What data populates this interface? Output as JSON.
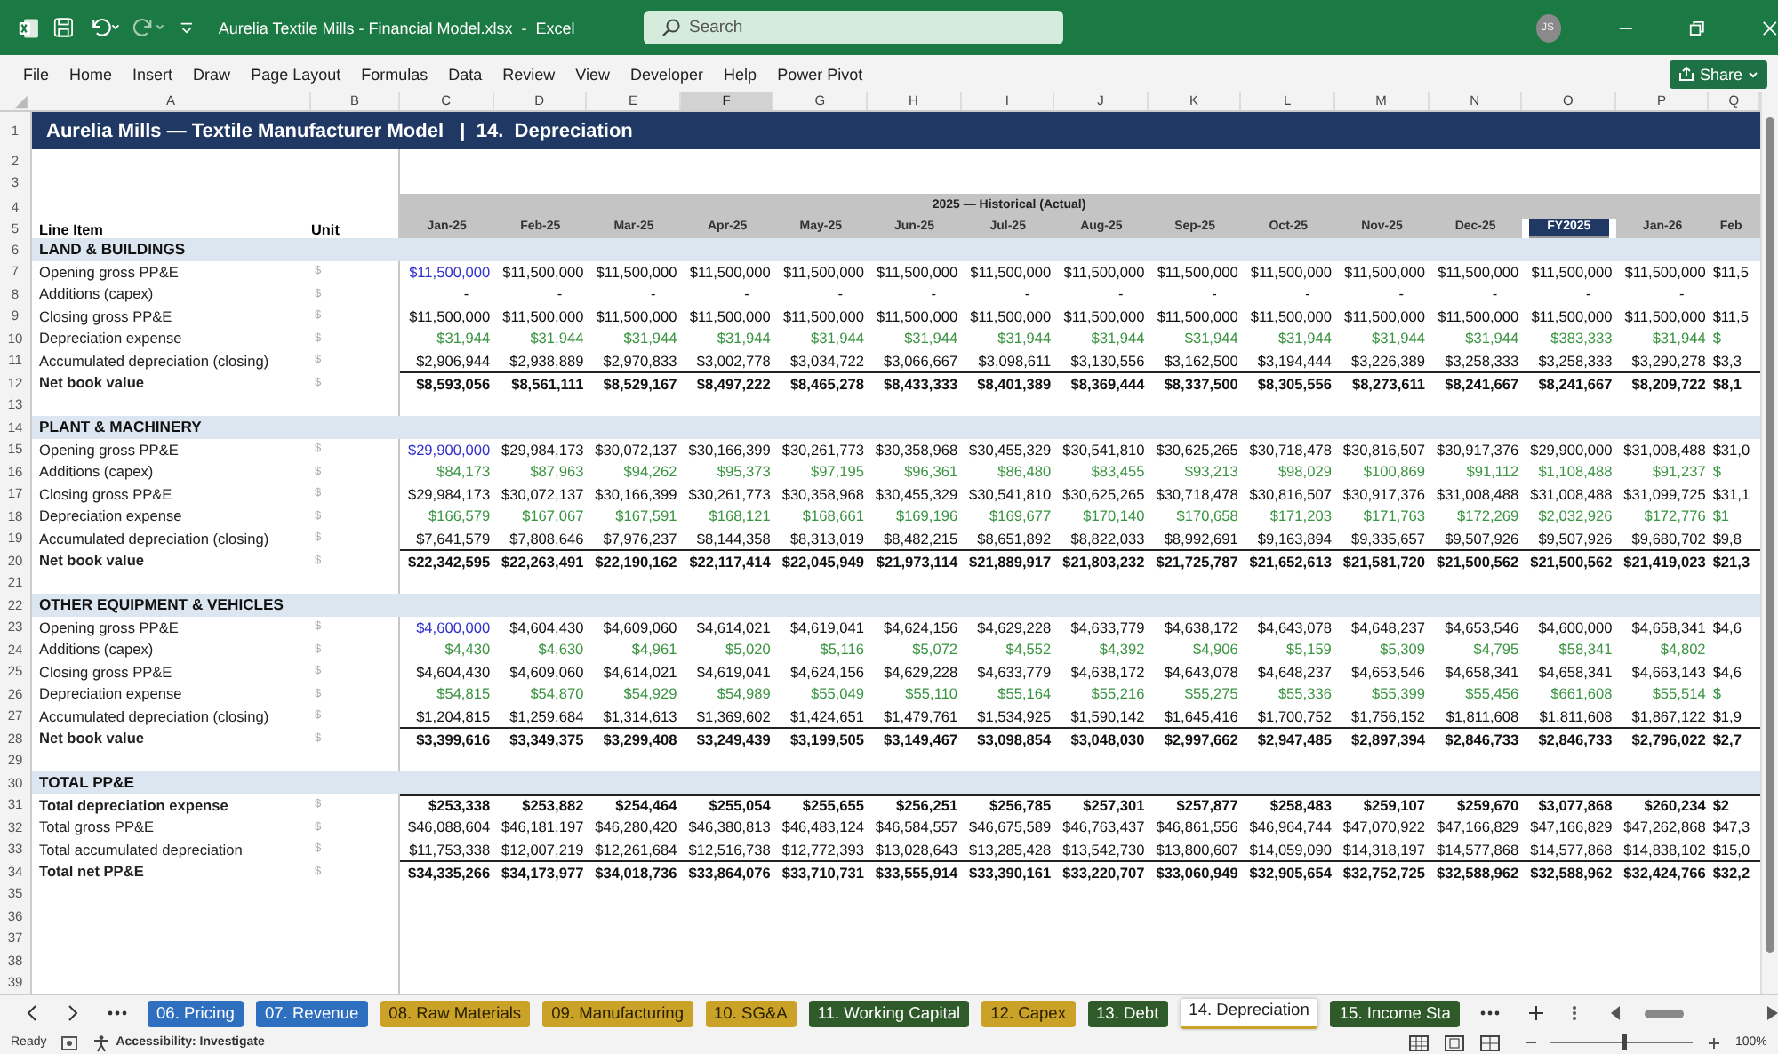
{
  "window": {
    "title": "Aurelia Textile Mills - Financial Model.xlsx  -  Excel",
    "search_placeholder": "Search",
    "avatar": "JS"
  },
  "menu": [
    "File",
    "Home",
    "Insert",
    "Draw",
    "Page Layout",
    "Formulas",
    "Data",
    "Review",
    "View",
    "Developer",
    "Help",
    "Power Pivot"
  ],
  "share": "Share",
  "columns": [
    {
      "letter": "A",
      "selected": false
    },
    {
      "letter": "B",
      "selected": false
    },
    {
      "letter": "C",
      "selected": false
    },
    {
      "letter": "D",
      "selected": false
    },
    {
      "letter": "E",
      "selected": false
    },
    {
      "letter": "F",
      "selected": true
    },
    {
      "letter": "G",
      "selected": false
    },
    {
      "letter": "H",
      "selected": false
    },
    {
      "letter": "I",
      "selected": false
    },
    {
      "letter": "J",
      "selected": false
    },
    {
      "letter": "K",
      "selected": false
    },
    {
      "letter": "L",
      "selected": false
    },
    {
      "letter": "M",
      "selected": false
    },
    {
      "letter": "N",
      "selected": false
    },
    {
      "letter": "O",
      "selected": false
    },
    {
      "letter": "P",
      "selected": false
    },
    {
      "letter": "Q",
      "selected": false
    }
  ],
  "rows": [
    {
      "number": "1",
      "kind": "title",
      "label": "Aurelia Mills — Textile Manufacturer Model   |  14.  Depreciation"
    },
    {
      "number": "2",
      "kind": "blank"
    },
    {
      "number": "3",
      "kind": "blank"
    },
    {
      "number": "4",
      "kind": "period-band",
      "period_label": "2025 — Historical (Actual)"
    },
    {
      "number": "5",
      "kind": "heading",
      "label": "Line Item",
      "unit": "Unit",
      "periods": [
        {
          "label": "Jan-25",
          "selected": false
        },
        {
          "label": "Feb-25",
          "selected": false
        },
        {
          "label": "Mar-25",
          "selected": false
        },
        {
          "label": "Apr-25",
          "selected": false
        },
        {
          "label": "May-25",
          "selected": false
        },
        {
          "label": "Jun-25",
          "selected": false
        },
        {
          "label": "Jul-25",
          "selected": false
        },
        {
          "label": "Aug-25",
          "selected": false
        },
        {
          "label": "Sep-25",
          "selected": false
        },
        {
          "label": "Oct-25",
          "selected": false
        },
        {
          "label": "Nov-25",
          "selected": false
        },
        {
          "label": "Dec-25",
          "selected": false
        },
        {
          "label": "FY2025",
          "selected": true
        },
        {
          "label": "Jan-26",
          "selected": false
        },
        {
          "label": "Feb",
          "selected": false
        }
      ]
    },
    {
      "number": "6",
      "kind": "section",
      "label": "LAND & BUILDINGS"
    },
    {
      "number": "7",
      "kind": "line",
      "label": "Opening gross PP&E",
      "unit": "$",
      "linked": false,
      "first_input": true,
      "values": [
        "$11,500,000",
        "$11,500,000",
        "$11,500,000",
        "$11,500,000",
        "$11,500,000",
        "$11,500,000",
        "$11,500,000",
        "$11,500,000",
        "$11,500,000",
        "$11,500,000",
        "$11,500,000",
        "$11,500,000",
        "$11,500,000",
        "$11,500,000"
      ],
      "cut_value": "$11,5"
    },
    {
      "number": "8",
      "kind": "line",
      "label": "Additions (capex)",
      "unit": "$",
      "linked": false,
      "first_input": false,
      "values": [
        "-",
        "-",
        "-",
        "-",
        "-",
        "-",
        "-",
        "-",
        "-",
        "-",
        "-",
        "-",
        "-",
        "-"
      ]
    },
    {
      "number": "9",
      "kind": "line",
      "label": "Closing gross PP&E",
      "unit": "$",
      "linked": false,
      "first_input": false,
      "values": [
        "$11,500,000",
        "$11,500,000",
        "$11,500,000",
        "$11,500,000",
        "$11,500,000",
        "$11,500,000",
        "$11,500,000",
        "$11,500,000",
        "$11,500,000",
        "$11,500,000",
        "$11,500,000",
        "$11,500,000",
        "$11,500,000",
        "$11,500,000"
      ],
      "cut_value": "$11,5"
    },
    {
      "number": "10",
      "kind": "line",
      "label": "Depreciation expense",
      "unit": "$",
      "linked": true,
      "first_input": false,
      "values": [
        "$31,944",
        "$31,944",
        "$31,944",
        "$31,944",
        "$31,944",
        "$31,944",
        "$31,944",
        "$31,944",
        "$31,944",
        "$31,944",
        "$31,944",
        "$31,944",
        "$383,333",
        "$31,944"
      ],
      "cut_value": "$"
    },
    {
      "number": "11",
      "kind": "line",
      "label": "Accumulated depreciation (closing)",
      "unit": "$",
      "linked": false,
      "first_input": false,
      "values": [
        "$2,906,944",
        "$2,938,889",
        "$2,970,833",
        "$3,002,778",
        "$3,034,722",
        "$3,066,667",
        "$3,098,611",
        "$3,130,556",
        "$3,162,500",
        "$3,194,444",
        "$3,226,389",
        "$3,258,333",
        "$3,258,333",
        "$3,290,278"
      ],
      "cut_value": "$3,3"
    },
    {
      "number": "12",
      "kind": "total",
      "label": "Net book value",
      "unit": "$",
      "linked": false,
      "first_input": false,
      "values": [
        "$8,593,056",
        "$8,561,111",
        "$8,529,167",
        "$8,497,222",
        "$8,465,278",
        "$8,433,333",
        "$8,401,389",
        "$8,369,444",
        "$8,337,500",
        "$8,305,556",
        "$8,273,611",
        "$8,241,667",
        "$8,241,667",
        "$8,209,722"
      ],
      "cut_value": "$8,1"
    },
    {
      "number": "13",
      "kind": "blank"
    },
    {
      "number": "14",
      "kind": "section",
      "label": "PLANT & MACHINERY"
    },
    {
      "number": "15",
      "kind": "line",
      "label": "Opening gross PP&E",
      "unit": "$",
      "linked": false,
      "first_input": true,
      "values": [
        "$29,900,000",
        "$29,984,173",
        "$30,072,137",
        "$30,166,399",
        "$30,261,773",
        "$30,358,968",
        "$30,455,329",
        "$30,541,810",
        "$30,625,265",
        "$30,718,478",
        "$30,816,507",
        "$30,917,376",
        "$29,900,000",
        "$31,008,488"
      ],
      "cut_value": "$31,0"
    },
    {
      "number": "16",
      "kind": "line",
      "label": "Additions (capex)",
      "unit": "$",
      "linked": true,
      "first_input": false,
      "values": [
        "$84,173",
        "$87,963",
        "$94,262",
        "$95,373",
        "$97,195",
        "$96,361",
        "$86,480",
        "$83,455",
        "$93,213",
        "$98,029",
        "$100,869",
        "$91,112",
        "$1,108,488",
        "$91,237"
      ],
      "cut_value": "$"
    },
    {
      "number": "17",
      "kind": "line",
      "label": "Closing gross PP&E",
      "unit": "$",
      "linked": false,
      "first_input": false,
      "values": [
        "$29,984,173",
        "$30,072,137",
        "$30,166,399",
        "$30,261,773",
        "$30,358,968",
        "$30,455,329",
        "$30,541,810",
        "$30,625,265",
        "$30,718,478",
        "$30,816,507",
        "$30,917,376",
        "$31,008,488",
        "$31,008,488",
        "$31,099,725"
      ],
      "cut_value": "$31,1"
    },
    {
      "number": "18",
      "kind": "line",
      "label": "Depreciation expense",
      "unit": "$",
      "linked": true,
      "first_input": false,
      "values": [
        "$166,579",
        "$167,067",
        "$167,591",
        "$168,121",
        "$168,661",
        "$169,196",
        "$169,677",
        "$170,140",
        "$170,658",
        "$171,203",
        "$171,763",
        "$172,269",
        "$2,032,926",
        "$172,776"
      ],
      "cut_value": "$1"
    },
    {
      "number": "19",
      "kind": "line",
      "label": "Accumulated depreciation (closing)",
      "unit": "$",
      "linked": false,
      "first_input": false,
      "values": [
        "$7,641,579",
        "$7,808,646",
        "$7,976,237",
        "$8,144,358",
        "$8,313,019",
        "$8,482,215",
        "$8,651,892",
        "$8,822,033",
        "$8,992,691",
        "$9,163,894",
        "$9,335,657",
        "$9,507,926",
        "$9,507,926",
        "$9,680,702"
      ],
      "cut_value": "$9,8"
    },
    {
      "number": "20",
      "kind": "total",
      "label": "Net book value",
      "unit": "$",
      "linked": false,
      "first_input": false,
      "values": [
        "$22,342,595",
        "$22,263,491",
        "$22,190,162",
        "$22,117,414",
        "$22,045,949",
        "$21,973,114",
        "$21,889,917",
        "$21,803,232",
        "$21,725,787",
        "$21,652,613",
        "$21,581,720",
        "$21,500,562",
        "$21,500,562",
        "$21,419,023"
      ],
      "cut_value": "$21,3"
    },
    {
      "number": "21",
      "kind": "blank"
    },
    {
      "number": "22",
      "kind": "section",
      "label": "OTHER EQUIPMENT & VEHICLES"
    },
    {
      "number": "23",
      "kind": "line",
      "label": "Opening gross PP&E",
      "unit": "$",
      "linked": false,
      "first_input": true,
      "values": [
        "$4,600,000",
        "$4,604,430",
        "$4,609,060",
        "$4,614,021",
        "$4,619,041",
        "$4,624,156",
        "$4,629,228",
        "$4,633,779",
        "$4,638,172",
        "$4,643,078",
        "$4,648,237",
        "$4,653,546",
        "$4,600,000",
        "$4,658,341"
      ],
      "cut_value": "$4,6"
    },
    {
      "number": "24",
      "kind": "line",
      "label": "Additions (capex)",
      "unit": "$",
      "linked": true,
      "first_input": false,
      "values": [
        "$4,430",
        "$4,630",
        "$4,961",
        "$5,020",
        "$5,116",
        "$5,072",
        "$4,552",
        "$4,392",
        "$4,906",
        "$5,159",
        "$5,309",
        "$4,795",
        "$58,341",
        "$4,802"
      ]
    },
    {
      "number": "25",
      "kind": "line",
      "label": "Closing gross PP&E",
      "unit": "$",
      "linked": false,
      "first_input": false,
      "values": [
        "$4,604,430",
        "$4,609,060",
        "$4,614,021",
        "$4,619,041",
        "$4,624,156",
        "$4,629,228",
        "$4,633,779",
        "$4,638,172",
        "$4,643,078",
        "$4,648,237",
        "$4,653,546",
        "$4,658,341",
        "$4,658,341",
        "$4,663,143"
      ],
      "cut_value": "$4,6"
    },
    {
      "number": "26",
      "kind": "line",
      "label": "Depreciation expense",
      "unit": "$",
      "linked": true,
      "first_input": false,
      "values": [
        "$54,815",
        "$54,870",
        "$54,929",
        "$54,989",
        "$55,049",
        "$55,110",
        "$55,164",
        "$55,216",
        "$55,275",
        "$55,336",
        "$55,399",
        "$55,456",
        "$661,608",
        "$55,514"
      ],
      "cut_value": "$"
    },
    {
      "number": "27",
      "kind": "line",
      "label": "Accumulated depreciation (closing)",
      "unit": "$",
      "linked": false,
      "first_input": false,
      "values": [
        "$1,204,815",
        "$1,259,684",
        "$1,314,613",
        "$1,369,602",
        "$1,424,651",
        "$1,479,761",
        "$1,534,925",
        "$1,590,142",
        "$1,645,416",
        "$1,700,752",
        "$1,756,152",
        "$1,811,608",
        "$1,811,608",
        "$1,867,122"
      ],
      "cut_value": "$1,9"
    },
    {
      "number": "28",
      "kind": "total",
      "label": "Net book value",
      "unit": "$",
      "linked": false,
      "first_input": false,
      "values": [
        "$3,399,616",
        "$3,349,375",
        "$3,299,408",
        "$3,249,439",
        "$3,199,505",
        "$3,149,467",
        "$3,098,854",
        "$3,048,030",
        "$2,997,662",
        "$2,947,485",
        "$2,897,394",
        "$2,846,733",
        "$2,846,733",
        "$2,796,022"
      ],
      "cut_value": "$2,7"
    },
    {
      "number": "29",
      "kind": "blank"
    },
    {
      "number": "30",
      "kind": "section",
      "label": "TOTAL PP&E"
    },
    {
      "number": "31",
      "kind": "total",
      "label": "Total depreciation expense",
      "unit": "$",
      "linked": false,
      "first_input": false,
      "values": [
        "$253,338",
        "$253,882",
        "$254,464",
        "$255,054",
        "$255,655",
        "$256,251",
        "$256,785",
        "$257,301",
        "$257,877",
        "$258,483",
        "$259,107",
        "$259,670",
        "$3,077,868",
        "$260,234"
      ],
      "cut_value": "$2"
    },
    {
      "number": "32",
      "kind": "line",
      "label": "Total gross PP&E",
      "unit": "$",
      "linked": false,
      "first_input": false,
      "values": [
        "$46,088,604",
        "$46,181,197",
        "$46,280,420",
        "$46,380,813",
        "$46,483,124",
        "$46,584,557",
        "$46,675,589",
        "$46,763,437",
        "$46,861,556",
        "$46,964,744",
        "$47,070,922",
        "$47,166,829",
        "$47,166,829",
        "$47,262,868"
      ],
      "cut_value": "$47,3"
    },
    {
      "number": "33",
      "kind": "line",
      "label": "Total accumulated depreciation",
      "unit": "$",
      "linked": false,
      "first_input": false,
      "values": [
        "$11,753,338",
        "$12,007,219",
        "$12,261,684",
        "$12,516,738",
        "$12,772,393",
        "$13,028,643",
        "$13,285,428",
        "$13,542,730",
        "$13,800,607",
        "$14,059,090",
        "$14,318,197",
        "$14,577,868",
        "$14,577,868",
        "$14,838,102"
      ],
      "cut_value": "$15,0"
    },
    {
      "number": "34",
      "kind": "total",
      "label": "Total net PP&E",
      "unit": "$",
      "linked": false,
      "first_input": false,
      "values": [
        "$34,335,266",
        "$34,173,977",
        "$34,018,736",
        "$33,864,076",
        "$33,710,731",
        "$33,555,914",
        "$33,390,161",
        "$33,220,707",
        "$33,060,949",
        "$32,905,654",
        "$32,752,725",
        "$32,588,962",
        "$32,588,962",
        "$32,424,766"
      ],
      "cut_value": "$32,2"
    },
    {
      "number": "35",
      "kind": "blank"
    },
    {
      "number": "36",
      "kind": "blank"
    },
    {
      "number": "37",
      "kind": "blank"
    },
    {
      "number": "38",
      "kind": "blank"
    },
    {
      "number": "39",
      "kind": "blank"
    }
  ],
  "tabs": [
    {
      "label": "06. Pricing",
      "color": "#2f6fbf",
      "selected": false
    },
    {
      "label": "07. Revenue",
      "color": "#2f6fbf",
      "selected": false
    },
    {
      "label": "08. Raw Materials",
      "color": "#c9a227",
      "selected": false
    },
    {
      "label": "09. Manufacturing",
      "color": "#c9a227",
      "selected": false
    },
    {
      "label": "10. SG&A",
      "color": "#c9a227",
      "selected": false
    },
    {
      "label": "11. Working Capital",
      "color": "#2f5a2a",
      "selected": false
    },
    {
      "label": "12. Capex",
      "color": "#c9a227",
      "selected": false
    },
    {
      "label": "13. Debt",
      "color": "#2f5a2a",
      "selected": false
    },
    {
      "label": "14. Depreciation",
      "color": "#c9a227",
      "selected": true
    },
    {
      "label": "15. Income Sta",
      "color": "#2f5a2a",
      "selected": false
    }
  ],
  "status_bar": {
    "state": "Ready",
    "accessibility": "Accessibility: Investigate",
    "zoom": {
      "level": 0.5,
      "reading": "100%"
    }
  }
}
